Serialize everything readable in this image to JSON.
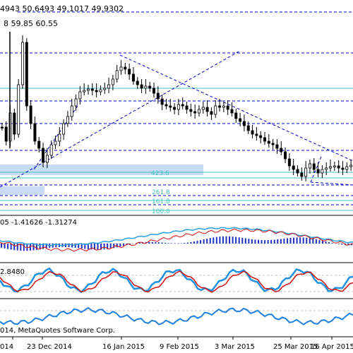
{
  "header": {
    "ohlc_text": "4943 50.6493 49.1017 49.9302",
    "ma_text": "8 59.85 60.55"
  },
  "fib_levels": {
    "l1": "423.6",
    "l2": "261.8",
    "l3": "161.8",
    "l4": "100.0"
  },
  "macd_text": "05 -1.41626 -1.31274",
  "stoch_text": "2.8480",
  "copyright_text": "014, MetaQuotes Software Corp.",
  "x_axis_labels": [
    "014",
    "23 Dec 2014",
    "16 Jan 2015",
    "9 Feb 2015",
    "3 Mar 2015",
    "25 Mar 2015",
    "16 Apr 2015"
  ],
  "colors": {
    "background": "#ffffff",
    "candles": "#000000",
    "trendline": "#0000c8",
    "fib": "#40c0c0",
    "zone": "#c8ddf5",
    "macd_signal_blue": "#2aa0e0",
    "macd_main_red": "#d01010",
    "macd_hist": "#2030c0",
    "stoch_main": "#2090e0",
    "stoch_signal": "#d01010",
    "third": "#2080e0"
  }
}
